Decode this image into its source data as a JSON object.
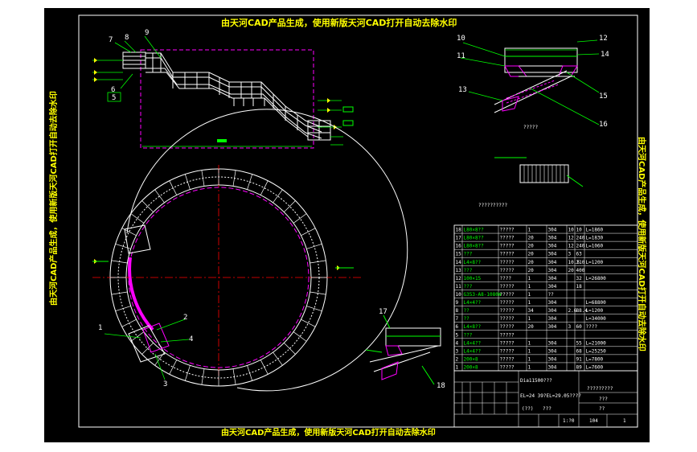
{
  "watermark": {
    "top": "由天河CAD产品生成，使用新版天河CAD打开自动去除水印",
    "bottom": "由天河CAD产品生成，使用新版天河CAD打开自动去除水印",
    "left": "由天河CAD产品生成，使用新版天河CAD打开自动去除水印",
    "right": "由天河CAD产品生成，使用新版天河CAD打开自动去除水印"
  },
  "callouts": {
    "c1": "1",
    "c2": "2",
    "c3": "3",
    "c4": "4",
    "c5": "5",
    "c6": "6",
    "c7": "7",
    "c8": "8",
    "c9": "9",
    "c10": "10",
    "c11": "11",
    "c12": "12",
    "c13": "13",
    "c14": "14",
    "c15": "15",
    "c16": "16",
    "c17": "17",
    "c18": "18"
  },
  "plan_note": "??????????",
  "side_view_label": "?????",
  "bom_rows": [
    {
      "no": "18",
      "spec": "L80×8??",
      "name": "?????",
      "qty": "1",
      "mat": "304",
      "unit": "10",
      "total": "10",
      "note": "L=1860"
    },
    {
      "no": "17",
      "spec": "L80×8??",
      "name": "?????",
      "qty": "20",
      "mat": "304",
      "unit": "12",
      "total": "240",
      "note": "L=1830"
    },
    {
      "no": "16",
      "spec": "L80×8??",
      "name": "?????",
      "qty": "20",
      "mat": "304",
      "unit": "12",
      "total": "240",
      "note": "L=1060"
    },
    {
      "no": "15",
      "spec": "???",
      "name": "?????",
      "qty": "20",
      "mat": "304",
      "unit": "3",
      "total": "63",
      "note": ""
    },
    {
      "no": "14",
      "spec": "L4×8??",
      "name": "?????",
      "qty": "20",
      "mat": "304",
      "unit": "10.5",
      "total": "210",
      "note": "L=1200"
    },
    {
      "no": "13",
      "spec": "???",
      "name": "?????",
      "qty": "20",
      "mat": "304",
      "unit": "20",
      "total": "400",
      "note": ""
    },
    {
      "no": "12",
      "spec": "100×15",
      "name": "????",
      "qty": "1",
      "mat": "304",
      "unit": "",
      "total": "32",
      "note": "L=26800"
    },
    {
      "no": "11",
      "spec": "???",
      "name": "?????",
      "qty": "1",
      "mat": "304",
      "unit": "",
      "total": "18",
      "note": ""
    },
    {
      "no": "10",
      "spec": "G353-A8-1080W",
      "name": "?????",
      "qty": "1",
      "mat": "??",
      "unit": "",
      "total": "",
      "note": ""
    },
    {
      "no": "9",
      "spec": "L4×4??",
      "name": "?????",
      "qty": "1",
      "mat": "304",
      "unit": "",
      "total": "",
      "note": "L=68800"
    },
    {
      "no": "8",
      "spec": "??",
      "name": "?????",
      "qty": "34",
      "mat": "304",
      "unit": "2.6",
      "total": "88.4",
      "note": "L=1200"
    },
    {
      "no": "7",
      "spec": "??",
      "name": "?????",
      "qty": "1",
      "mat": "304",
      "unit": "",
      "total": "",
      "note": "L=34000"
    },
    {
      "no": "6",
      "spec": "L4×8??",
      "name": "?????",
      "qty": "20",
      "mat": "304",
      "unit": "3",
      "total": "60",
      "note": "????"
    },
    {
      "no": "5",
      "spec": "???",
      "name": "?????",
      "qty": "",
      "mat": "",
      "unit": "",
      "total": "",
      "note": ""
    },
    {
      "no": "4",
      "spec": "L4×4??",
      "name": "?????",
      "qty": "1",
      "mat": "304",
      "unit": "",
      "total": "55",
      "note": "L=21000"
    },
    {
      "no": "3",
      "spec": "L4×4??",
      "name": "?????",
      "qty": "1",
      "mat": "304",
      "unit": "",
      "total": "68",
      "note": "L=25250"
    },
    {
      "no": "2",
      "spec": "200×8",
      "name": "?????",
      "qty": "1",
      "mat": "304",
      "unit": "",
      "total": "91",
      "note": "L=7800"
    },
    {
      "no": "1",
      "spec": "200×8",
      "name": "?????",
      "qty": "1",
      "mat": "304",
      "unit": "",
      "total": "89",
      "note": "L=7600"
    }
  ],
  "title_block": {
    "dia": "Dia11500???",
    "elev": "EL=24 39?EL=29.05????",
    "drawing_name": "?????????",
    "sub1": "???",
    "sub2": "??",
    "scale": "1:?0",
    "sheet": "104",
    "sheets": "1",
    "small1": "(??)",
    "small2": "???"
  }
}
